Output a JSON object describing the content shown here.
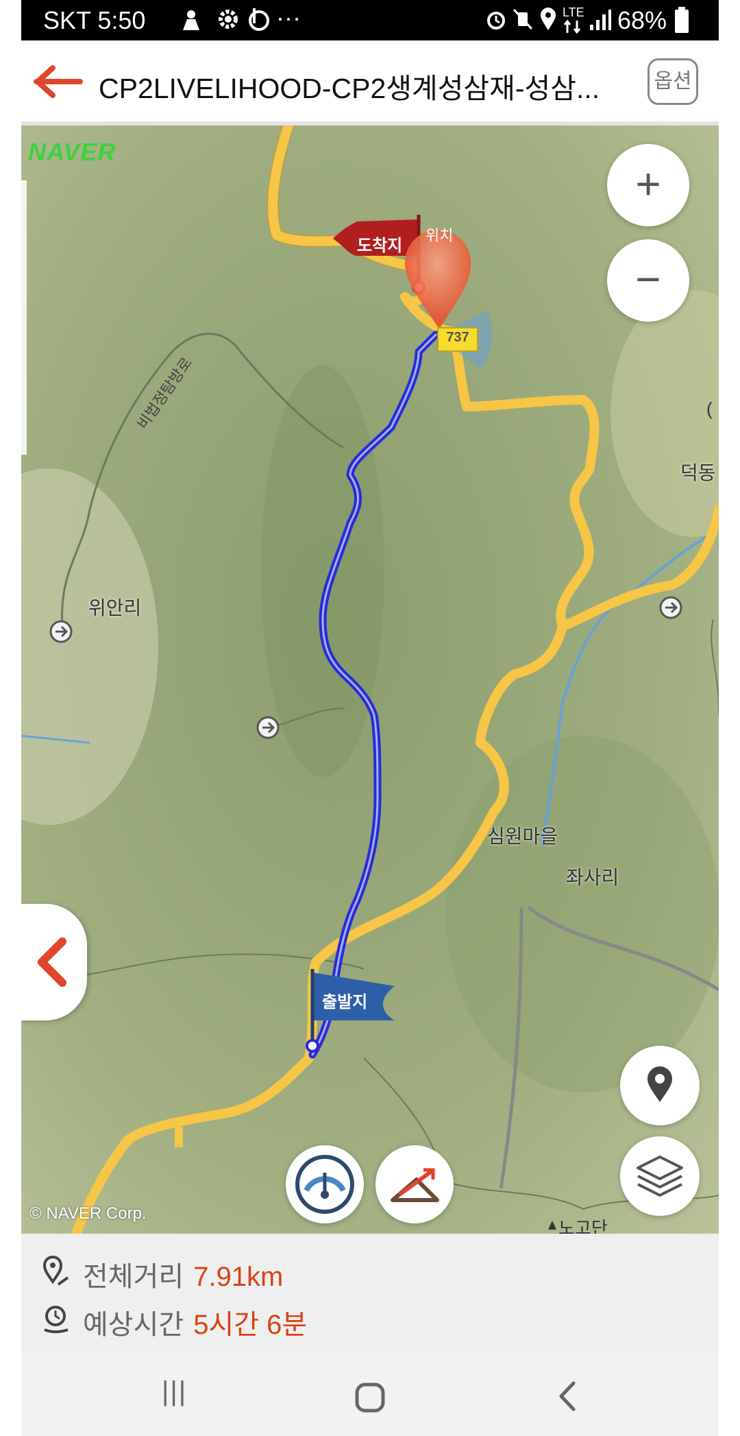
{
  "status": {
    "carrier_time": "SKT 5:50",
    "more": "···",
    "network": "LTE",
    "battery": "68%"
  },
  "header": {
    "title": "CP2LIVELIHOOD-CP2생계성삼재-성삼...",
    "options_label": "옵션"
  },
  "map": {
    "brand": "NAVER",
    "copyright": "© NAVER Corp.",
    "labels": {
      "arrival": "도착지",
      "location": "위치",
      "departure": "출발지",
      "road_number": "737",
      "wian_ri": "위안리",
      "deokdong": "덕동",
      "simwon": "심원마을",
      "jwasa_ri": "좌사리",
      "road_name": "비법정탐방로",
      "bottom_peak": "노고단",
      "edge_paren": "("
    },
    "zoom_in": "+",
    "zoom_out": "−"
  },
  "summary": {
    "distance_label": "전체거리",
    "distance_value": "7.91km",
    "time_label": "예상시간",
    "time_value": "5시간 6분"
  },
  "nav": {
    "recents": "|||"
  },
  "colors": {
    "accent": "#d84315",
    "route": "#2a2ad6",
    "road": "#f7c646"
  }
}
